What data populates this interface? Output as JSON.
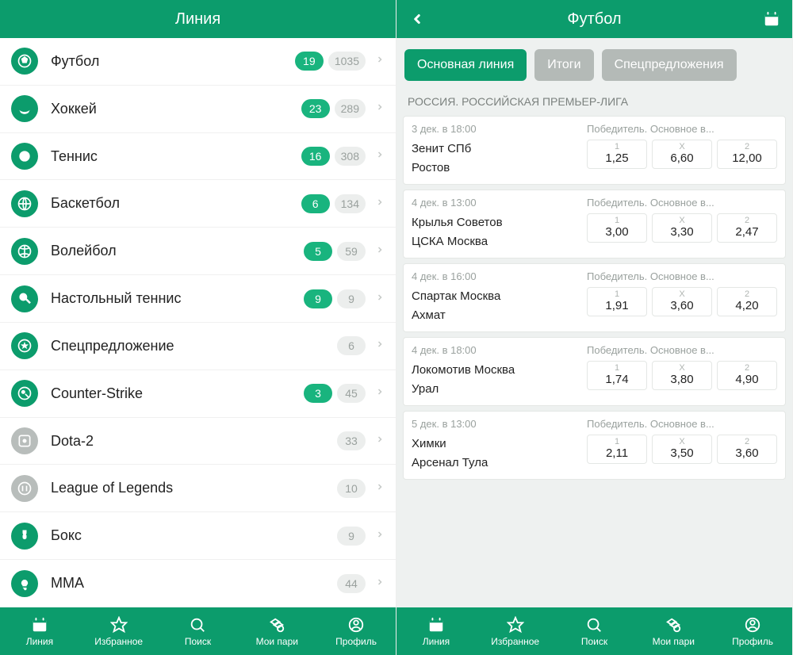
{
  "left": {
    "title": "Линия",
    "sports": [
      {
        "name": "Футбол",
        "live": "19",
        "total": "1035",
        "iconGrey": false
      },
      {
        "name": "Хоккей",
        "live": "23",
        "total": "289",
        "iconGrey": false
      },
      {
        "name": "Теннис",
        "live": "16",
        "total": "308",
        "iconGrey": false
      },
      {
        "name": "Баскетбол",
        "live": "6",
        "total": "134",
        "iconGrey": false
      },
      {
        "name": "Волейбол",
        "live": "5",
        "total": "59",
        "iconGrey": false
      },
      {
        "name": "Настольный теннис",
        "live": "9",
        "total": "9",
        "iconGrey": false
      },
      {
        "name": "Спецпредложение",
        "live": null,
        "total": "6",
        "iconGrey": false
      },
      {
        "name": "Counter-Strike",
        "live": "3",
        "total": "45",
        "iconGrey": false
      },
      {
        "name": "Dota-2",
        "live": null,
        "total": "33",
        "iconGrey": true
      },
      {
        "name": "League of Legends",
        "live": null,
        "total": "10",
        "iconGrey": true
      },
      {
        "name": "Бокс",
        "live": null,
        "total": "9",
        "iconGrey": false
      },
      {
        "name": "MMA",
        "live": null,
        "total": "44",
        "iconGrey": false
      }
    ]
  },
  "right": {
    "title": "Футбол",
    "tabs": [
      {
        "label": "Основная линия",
        "active": true
      },
      {
        "label": "Итоги",
        "active": false
      },
      {
        "label": "Спецпредложения",
        "active": false
      }
    ],
    "league": "РОССИЯ. РОССИЙСКАЯ ПРЕМЬЕР-ЛИГА",
    "betTitle": "Победитель. Основное в...",
    "oddKeys": [
      "1",
      "X",
      "2"
    ],
    "matches": [
      {
        "time": "3 дек. в 18:00",
        "t1": "Зенит СПб",
        "t2": "Ростов",
        "odds": [
          "1,25",
          "6,60",
          "12,00"
        ]
      },
      {
        "time": "4 дек. в 13:00",
        "t1": "Крылья Советов",
        "t2": "ЦСКА Москва",
        "odds": [
          "3,00",
          "3,30",
          "2,47"
        ]
      },
      {
        "time": "4 дек. в 16:00",
        "t1": "Спартак Москва",
        "t2": "Ахмат",
        "odds": [
          "1,91",
          "3,60",
          "4,20"
        ]
      },
      {
        "time": "4 дек. в 18:00",
        "t1": "Локомотив Москва",
        "t2": "Урал",
        "odds": [
          "1,74",
          "3,80",
          "4,90"
        ]
      },
      {
        "time": "5 дек. в 13:00",
        "t1": "Химки",
        "t2": "Арсенал Тула",
        "odds": [
          "2,11",
          "3,50",
          "3,60"
        ]
      }
    ]
  },
  "nav": {
    "items": [
      {
        "label": "Линия"
      },
      {
        "label": "Избранное"
      },
      {
        "label": "Поиск"
      },
      {
        "label": "Мои пари"
      },
      {
        "label": "Профиль"
      }
    ]
  }
}
